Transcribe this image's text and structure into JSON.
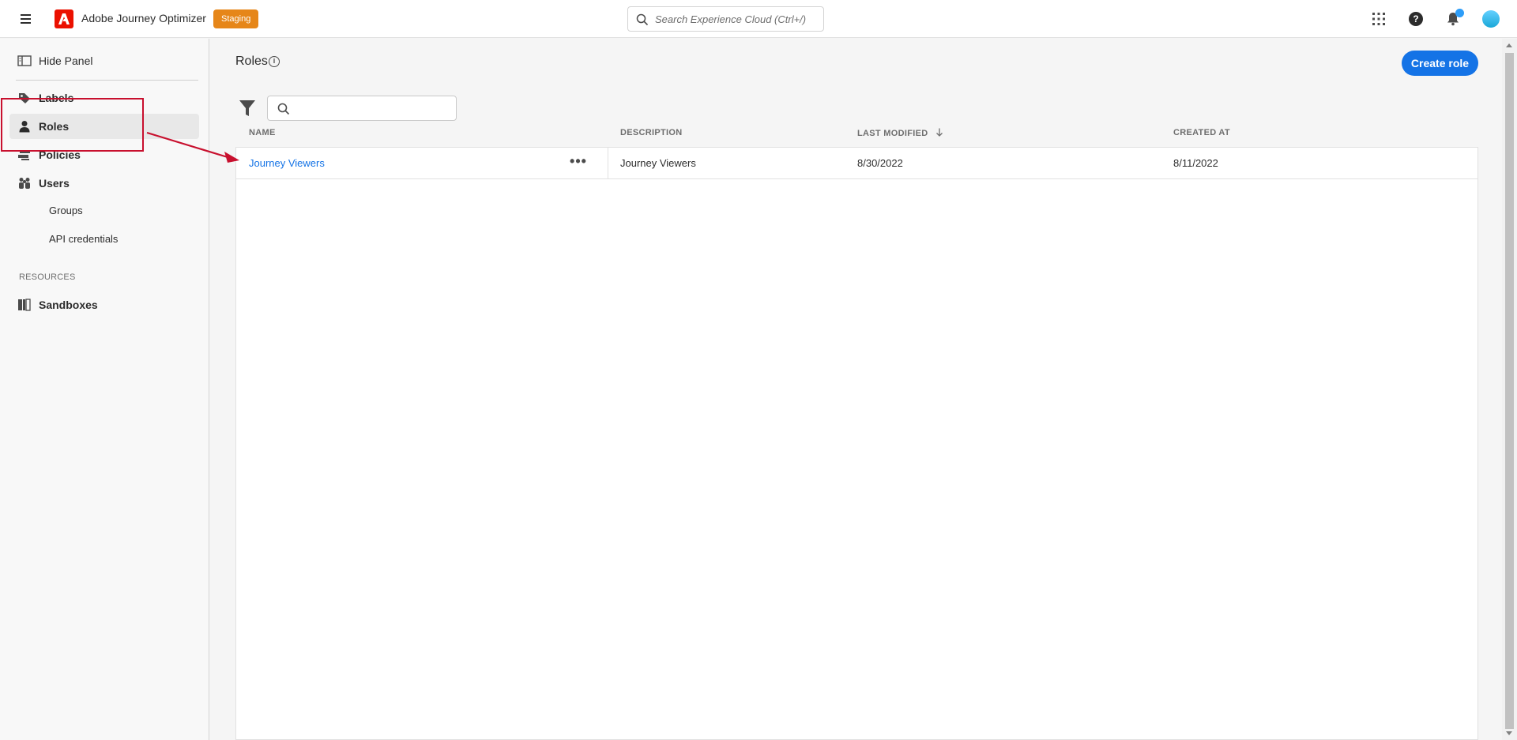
{
  "header": {
    "app_title": "Adobe Journey Optimizer",
    "environment_badge": "Staging",
    "search_placeholder": "Search Experience Cloud (Ctrl+/)",
    "icons": [
      "menu-icon",
      "adobe-logo-icon",
      "search-icon",
      "apps-grid-icon",
      "help-icon",
      "notifications-bell-icon",
      "user-avatar"
    ]
  },
  "sidebar": {
    "hide_panel_label": "Hide Panel",
    "items": [
      {
        "label": "Labels",
        "icon": "tag-icon"
      },
      {
        "label": "Roles",
        "icon": "person-icon",
        "active": true
      },
      {
        "label": "Policies",
        "icon": "policy-icon"
      },
      {
        "label": "Users",
        "icon": "users-icon"
      }
    ],
    "sub_items": [
      "Groups",
      "API credentials"
    ],
    "section_label": "RESOURCES",
    "resource_items": [
      {
        "label": "Sandboxes",
        "icon": "sandbox-icon"
      }
    ]
  },
  "main": {
    "page_title": "Roles",
    "create_button_label": "Create role",
    "table": {
      "columns": [
        "NAME",
        "DESCRIPTION",
        "LAST MODIFIED",
        "CREATED AT"
      ],
      "sorted_column": "LAST MODIFIED",
      "sort_direction": "descending",
      "rows": [
        {
          "name": "Journey Viewers",
          "description": "Journey Viewers",
          "last_modified": "8/30/2022",
          "created_at": "8/11/2022"
        }
      ]
    }
  },
  "colors": {
    "accent": "#1473e6",
    "badge": "#e68619",
    "brand": "#eb1000",
    "annotation": "#c8102e"
  }
}
